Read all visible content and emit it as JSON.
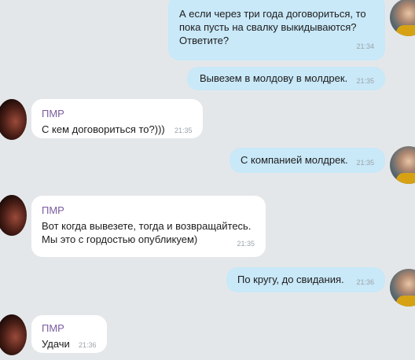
{
  "contact_name": "ПМР",
  "messages": [
    {
      "dir": "out",
      "text": "А если через три года договориться,  то\nпока пусть на свалку выкидываются?\nОтветите?",
      "time": "21:34"
    },
    {
      "dir": "out",
      "text": "Вывезем в молдову в молдрек.",
      "time": "21:35"
    },
    {
      "dir": "in",
      "sender": "ПМР",
      "text": "С кем договориться то?)))",
      "time": "21:35"
    },
    {
      "dir": "out",
      "text": "С компанией молдрек.",
      "time": "21:35"
    },
    {
      "dir": "in",
      "sender": "ПМР",
      "text": "Вот когда вывезете, тогда и возвращайтесь.\nМы это с гордостью опубликуем)",
      "time": "21:35"
    },
    {
      "dir": "out",
      "text": "По кругу,  до свидания.",
      "time": "21:36"
    },
    {
      "dir": "in",
      "sender": "ПМР",
      "text": "Удачи",
      "time": "21:36"
    }
  ]
}
